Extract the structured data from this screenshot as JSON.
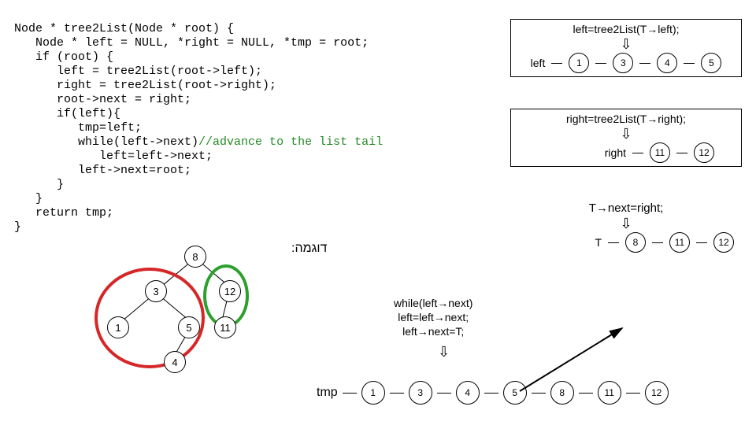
{
  "code": {
    "l1": "Node * tree2List(Node * root) {",
    "l2": "   Node * left = NULL, *right = NULL, *tmp = root;",
    "l3": "   if (root) {",
    "l4": "      left = tree2List(root->left);",
    "l5": "      right = tree2List(root->right);",
    "l6": "      root->next = right;",
    "l7": "      if(left){",
    "l8": "         tmp=left;",
    "l9a": "         while(left->next)",
    "l9b": "//advance to the list tail",
    "l10": "            left=left->next;",
    "l11": "         left->next=root;",
    "l12": "      }",
    "l13": "   }",
    "l14": "   return tmp;",
    "l15": "}"
  },
  "example_label": "דוגמה:",
  "tree_nodes": {
    "n8": "8",
    "n3": "3",
    "n12": "12",
    "n1": "1",
    "n5": "5",
    "n11": "11",
    "n4": "4"
  },
  "panel_left": {
    "title": "left=tree2List(T→left);",
    "label": "left",
    "nodes": [
      "1",
      "3",
      "4",
      "5"
    ]
  },
  "panel_right": {
    "title": "right=tree2List(T→right);",
    "label": "right",
    "nodes": [
      "11",
      "12"
    ]
  },
  "panel_t": {
    "title": "T→next=right;",
    "label": "T",
    "nodes": [
      "8",
      "11",
      "12"
    ]
  },
  "bottom_text": {
    "l1": "while(left→next)",
    "l2": "  left=left→next;",
    "l3": "left→next=T;"
  },
  "tmp_list": {
    "label": "tmp",
    "nodes": [
      "1",
      "3",
      "4",
      "5",
      "8",
      "11",
      "12"
    ]
  },
  "chart_data": {
    "type": "diagram",
    "tree": {
      "root": 8,
      "children": {
        "8": [
          3,
          12
        ],
        "3": [
          1,
          5
        ],
        "12": [
          11,
          null
        ],
        "5": [
          4,
          null
        ]
      }
    },
    "left_list": [
      1,
      3,
      4,
      5
    ],
    "right_list": [
      11,
      12
    ],
    "t_list": [
      8,
      11,
      12
    ],
    "tmp_list": [
      1,
      3,
      4,
      5,
      8,
      11,
      12
    ],
    "highlight_red": [
      3,
      1,
      5,
      4
    ],
    "highlight_green": [
      12,
      11
    ]
  }
}
